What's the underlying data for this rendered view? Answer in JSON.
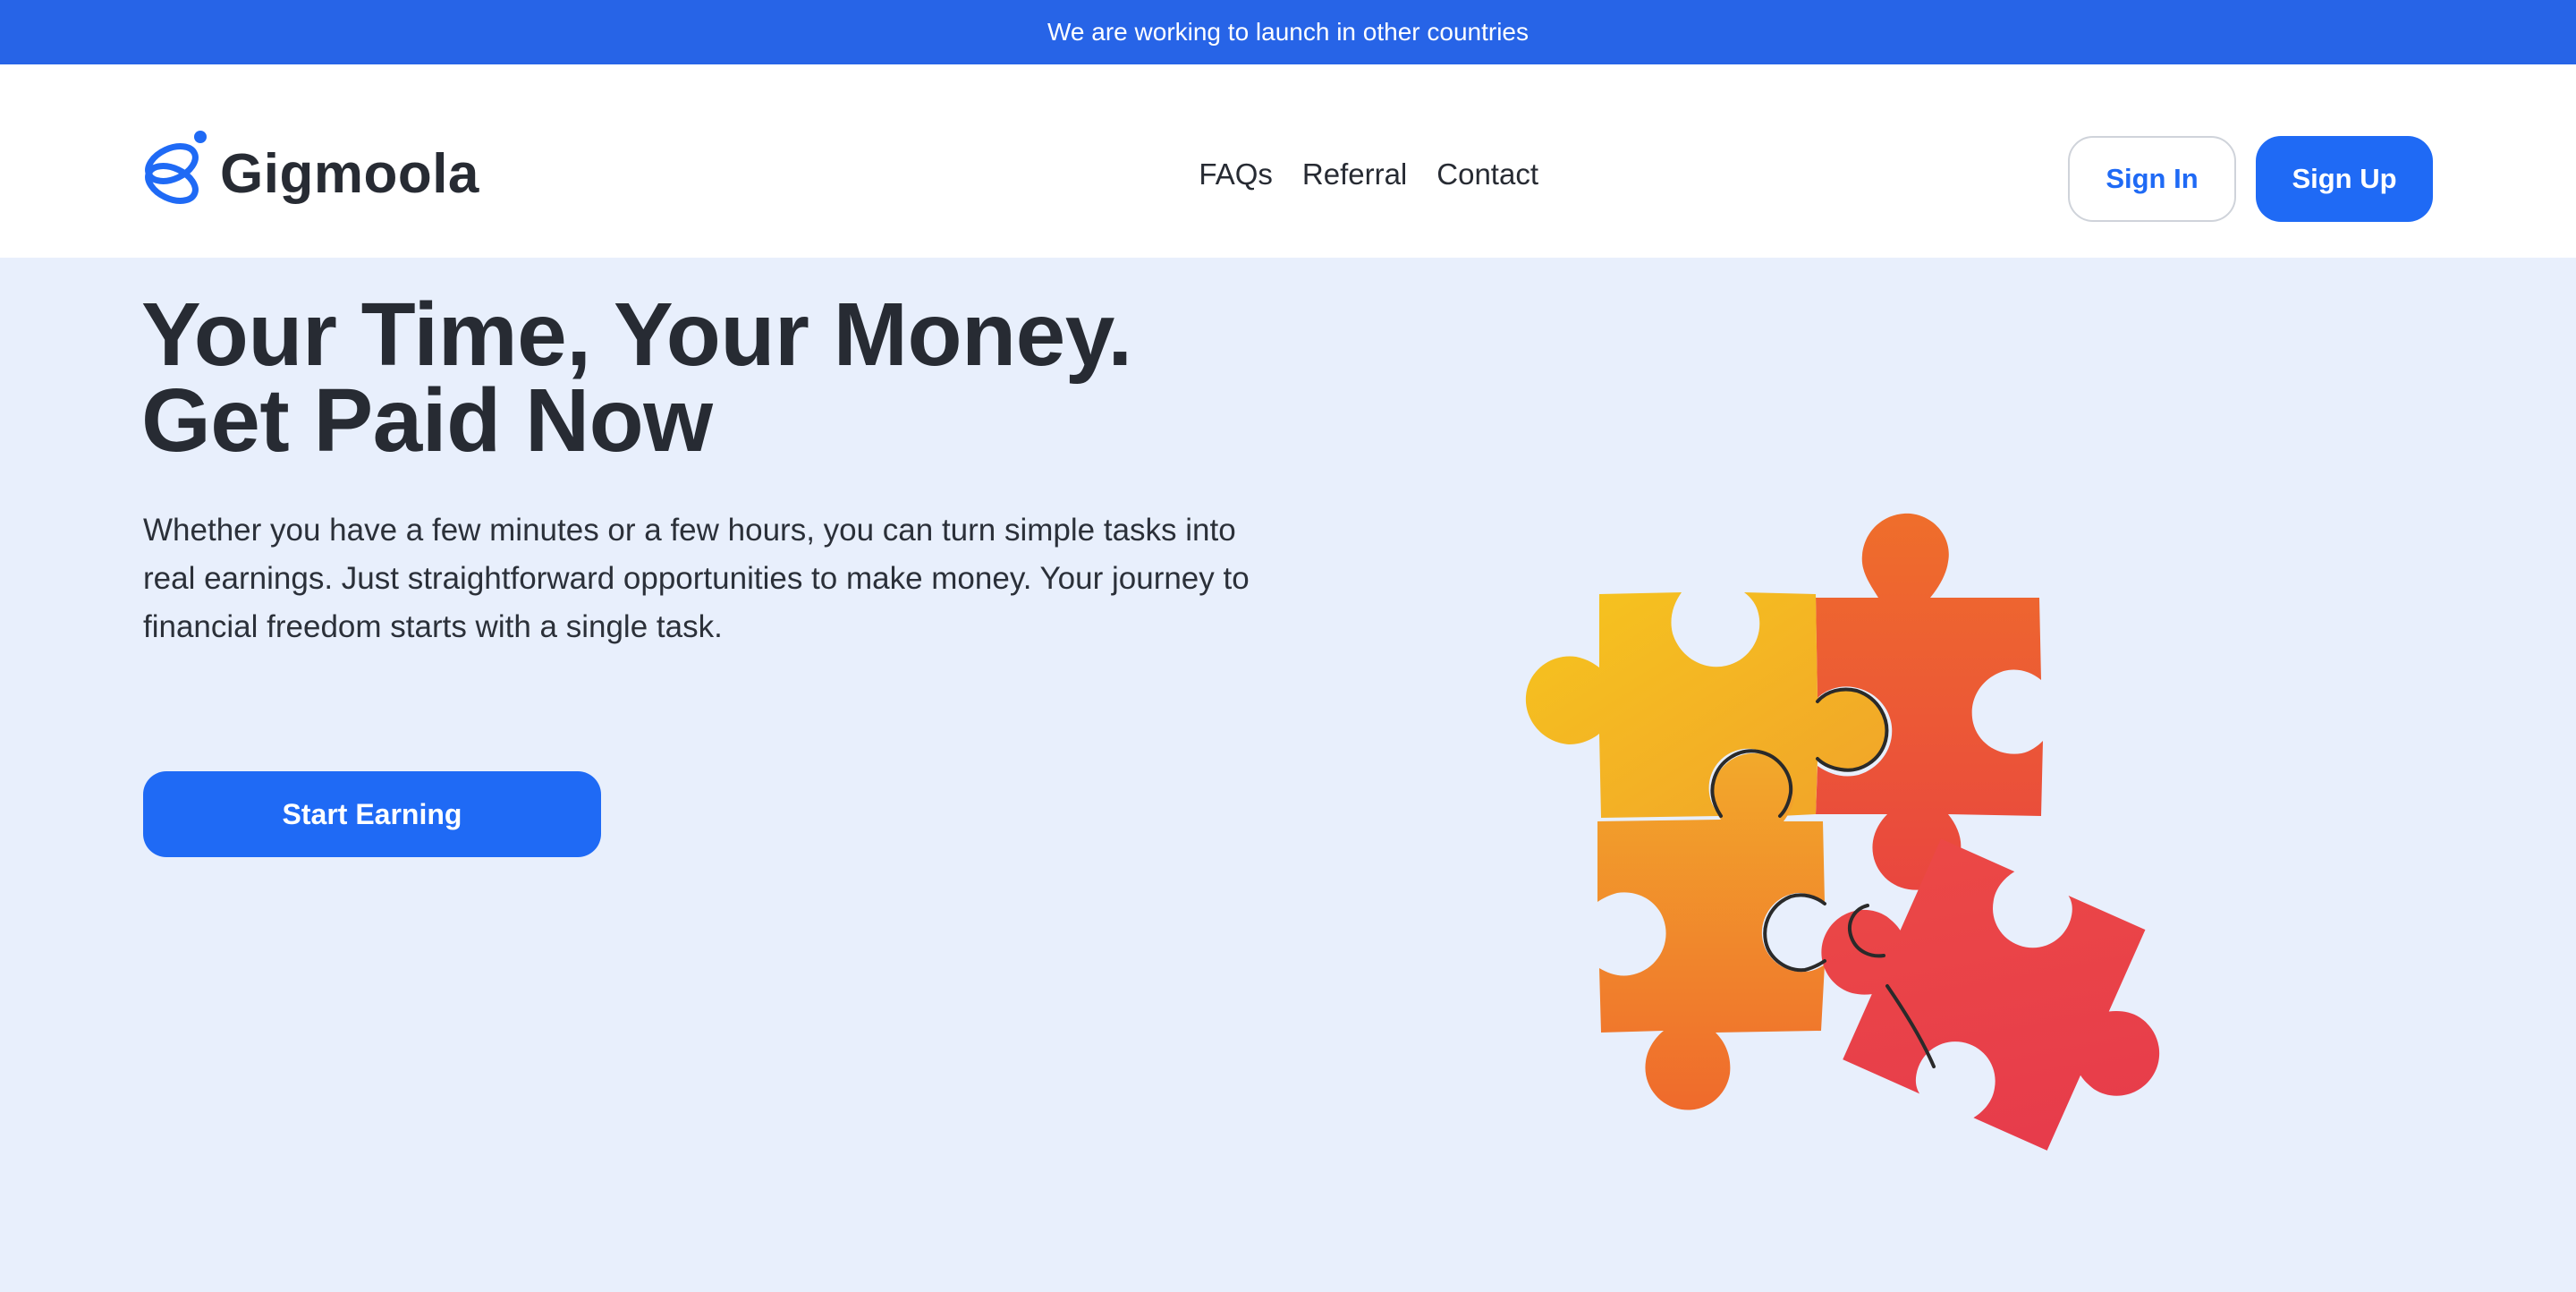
{
  "announcement": {
    "text": "We are working to launch in other countries"
  },
  "header": {
    "brand": "Gigmoola",
    "logo_icon": "gigmoola-logo-icon",
    "nav": [
      {
        "label": "FAQs"
      },
      {
        "label": "Referral"
      },
      {
        "label": "Contact"
      }
    ],
    "sign_in_label": "Sign In",
    "sign_up_label": "Sign Up"
  },
  "hero": {
    "headline_line1": "Your Time, Your Money.",
    "headline_line2": "Get Paid Now",
    "subtext": "Whether you have a few minutes or a few hours, you can turn simple tasks into real earnings. Just straightforward opportunities to make money. Your journey to financial freedom starts with a single task.",
    "cta_label": "Start Earning",
    "illustration": "puzzle-pieces-illustration"
  },
  "colors": {
    "brand_blue": "#1f6af5",
    "announce_bar": "#2764e7",
    "hero_bg": "#e8effc",
    "text_dark": "#272b33",
    "puzzle_yellow": "#f4c020",
    "puzzle_orange": "#ef6c2c",
    "puzzle_red": "#e8384a"
  }
}
